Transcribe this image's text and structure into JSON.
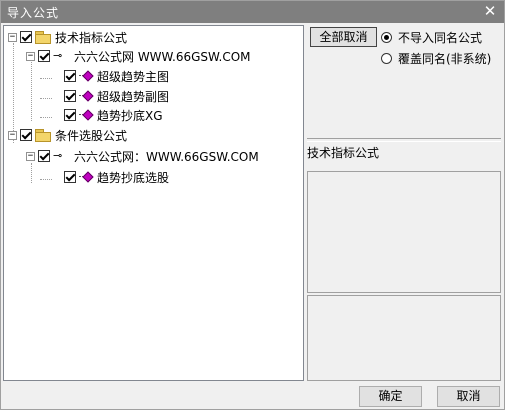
{
  "window": {
    "title": "导入公式",
    "close_symbol": "✕"
  },
  "tree": {
    "group1": {
      "expander": "−",
      "label": "技术指标公式",
      "checked": true
    },
    "source1": {
      "expander": "−",
      "key_glyph": "⊸",
      "label": "六六公式网 WWW.66GSW.COM",
      "checked": true
    },
    "items1": [
      {
        "label": "超级趋势主图",
        "checked": true
      },
      {
        "label": "超级趋势副图",
        "checked": true
      },
      {
        "label": "趋势抄底XG",
        "checked": true
      }
    ],
    "group2": {
      "expander": "−",
      "label": "条件选股公式",
      "checked": true
    },
    "source2": {
      "expander": "−",
      "key_glyph": "⊸",
      "label": "六六公式网：WWW.66GSW.COM",
      "checked": true
    },
    "items2": [
      {
        "label": "趋势抄底选股",
        "checked": true
      }
    ]
  },
  "options": {
    "select_all_label": "全部取消",
    "radio_no_import": "不导入同名公式",
    "radio_overwrite": "覆盖同名(非系统)"
  },
  "detail": {
    "category_label": "技术指标公式"
  },
  "footer": {
    "ok_label": "确定",
    "cancel_label": "取消"
  },
  "colors": {
    "titlebar": "#7f7f7f",
    "window_bg": "#f0f0f0",
    "formula_icon": "#c000c0",
    "folder": "#f3d56a"
  }
}
